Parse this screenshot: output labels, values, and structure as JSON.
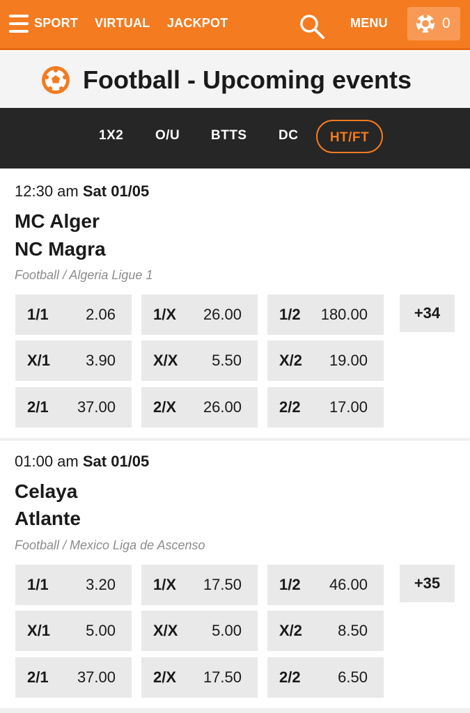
{
  "header": {
    "nav": [
      "SPORT",
      "VIRTUAL",
      "JACKPOT"
    ],
    "menu_label": "MENU",
    "betslip_count": "0",
    "icons": [
      "hamburger-icon",
      "search-icon",
      "ball-icon"
    ],
    "accent_color": "#f47b20"
  },
  "page": {
    "title": "Football - Upcoming events"
  },
  "tabs": [
    {
      "label": "1X2",
      "active": false
    },
    {
      "label": "O/U",
      "active": false
    },
    {
      "label": "BTTS",
      "active": false
    },
    {
      "label": "DC",
      "active": false
    },
    {
      "label": "HT/FT",
      "active": true
    }
  ],
  "events": [
    {
      "time": "12:30 am",
      "date": "Sat 01/05",
      "home": "MC Alger",
      "away": "NC Magra",
      "league": "Football / Algeria Ligue 1",
      "more": "+34",
      "odds": [
        [
          {
            "label": "1/1",
            "value": "2.06"
          },
          {
            "label": "1/X",
            "value": "26.00"
          },
          {
            "label": "1/2",
            "value": "180.00"
          }
        ],
        [
          {
            "label": "X/1",
            "value": "3.90"
          },
          {
            "label": "X/X",
            "value": "5.50"
          },
          {
            "label": "X/2",
            "value": "19.00"
          }
        ],
        [
          {
            "label": "2/1",
            "value": "37.00"
          },
          {
            "label": "2/X",
            "value": "26.00"
          },
          {
            "label": "2/2",
            "value": "17.00"
          }
        ]
      ]
    },
    {
      "time": "01:00 am",
      "date": "Sat 01/05",
      "home": "Celaya",
      "away": "Atlante",
      "league": "Football / Mexico Liga de Ascenso",
      "more": "+35",
      "odds": [
        [
          {
            "label": "1/1",
            "value": "3.20"
          },
          {
            "label": "1/X",
            "value": "17.50"
          },
          {
            "label": "1/2",
            "value": "46.00"
          }
        ],
        [
          {
            "label": "X/1",
            "value": "5.00"
          },
          {
            "label": "X/X",
            "value": "5.00"
          },
          {
            "label": "X/2",
            "value": "8.50"
          }
        ],
        [
          {
            "label": "2/1",
            "value": "37.00"
          },
          {
            "label": "2/X",
            "value": "17.50"
          },
          {
            "label": "2/2",
            "value": "6.50"
          }
        ]
      ]
    }
  ]
}
